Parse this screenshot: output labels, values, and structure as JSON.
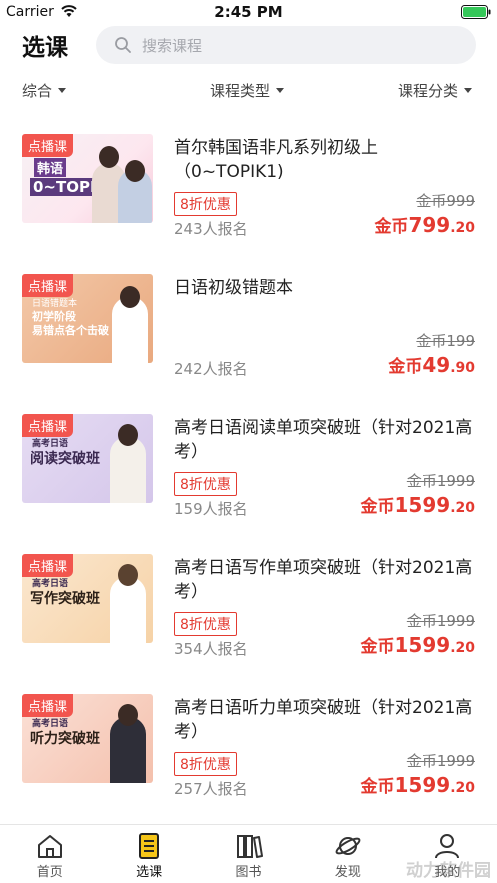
{
  "status_bar": {
    "carrier": "Carrier",
    "time": "2:45 PM"
  },
  "header": {
    "title": "选课",
    "search_placeholder": "搜索课程"
  },
  "filters": [
    "综合",
    "课程类型",
    "课程分类"
  ],
  "courses": [
    {
      "tag": "点播课",
      "thumb_lines": [
        "韩语",
        "0~TOPIK1"
      ],
      "title": "首尔韩国语非凡系列初级上（0~TOPIK1)",
      "discount": "8折优惠",
      "enrolled": "243人报名",
      "original_price": "金币999",
      "price_prefix": "金币",
      "price_int": "799",
      "price_dec": ".20"
    },
    {
      "tag": "点播课",
      "thumb_lines": [
        "日语错题本",
        "初学阶段",
        "易错点各个击破"
      ],
      "title": "日语初级错题本",
      "discount": "",
      "enrolled": "242人报名",
      "original_price": "金币199",
      "price_prefix": "金币",
      "price_int": "49",
      "price_dec": ".90"
    },
    {
      "tag": "点播课",
      "thumb_lines": [
        "高考日语",
        "阅读突破班"
      ],
      "title": "高考日语阅读单项突破班（针对2021高考）",
      "discount": "8折优惠",
      "enrolled": "159人报名",
      "original_price": "金币1999",
      "price_prefix": "金币",
      "price_int": "1599",
      "price_dec": ".20"
    },
    {
      "tag": "点播课",
      "thumb_lines": [
        "高考日语",
        "写作突破班"
      ],
      "title": "高考日语写作单项突破班（针对2021高考）",
      "discount": "8折优惠",
      "enrolled": "354人报名",
      "original_price": "金币1999",
      "price_prefix": "金币",
      "price_int": "1599",
      "price_dec": ".20"
    },
    {
      "tag": "点播课",
      "thumb_lines": [
        "高考日语",
        "听力突破班"
      ],
      "title": "高考日语听力单项突破班（针对2021高考）",
      "discount": "8折优惠",
      "enrolled": "257人报名",
      "original_price": "金币1999",
      "price_prefix": "金币",
      "price_int": "1599",
      "price_dec": ".20"
    }
  ],
  "tabs": [
    {
      "label": "首页",
      "icon": "home-icon"
    },
    {
      "label": "选课",
      "icon": "course-list-icon",
      "active": true
    },
    {
      "label": "图书",
      "icon": "books-icon"
    },
    {
      "label": "发现",
      "icon": "planet-icon"
    },
    {
      "label": "我的",
      "icon": "profile-icon"
    }
  ],
  "watermark": "动力软件园",
  "colors": {
    "accent_red": "#e33a30",
    "tag_red": "#f2554e",
    "tab_active": "#f5c518"
  }
}
